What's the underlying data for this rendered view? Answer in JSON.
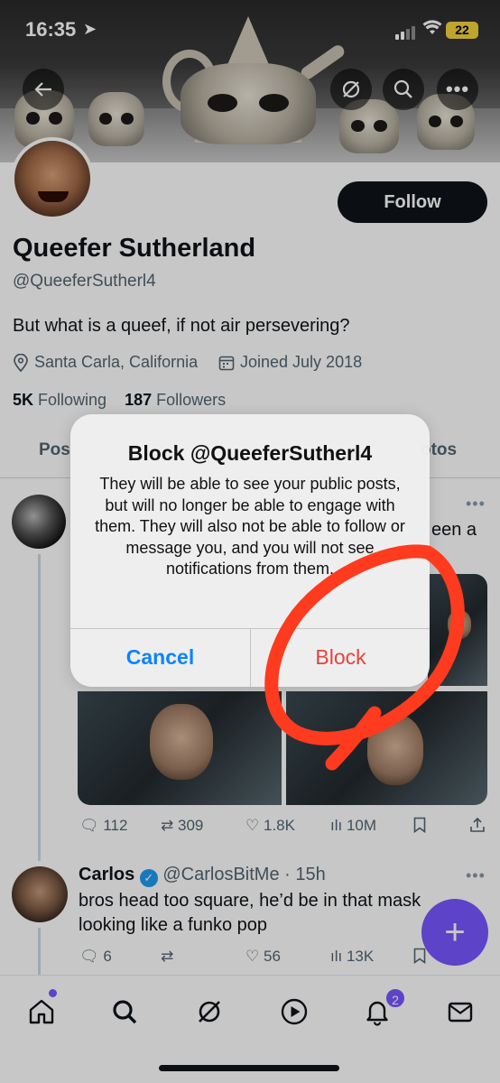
{
  "status_bar": {
    "time": "16:35",
    "battery": "22"
  },
  "profile": {
    "follow_label": "Follow",
    "name": "Queefer Sutherland",
    "handle": "@QueeferSutherl4",
    "bio": "But what is a queef, if not air persevering?",
    "location": "Santa Carla, California",
    "joined": "Joined July 2018",
    "following_count": "5K",
    "following_label": "Following",
    "followers_count": "187",
    "followers_label": "Followers"
  },
  "tabs": [
    "Pos",
    "otos"
  ],
  "tweet1": {
    "text_fragment": "een a",
    "actions": {
      "replies": "112",
      "retweets": "309",
      "likes": "1.8K",
      "views": "10M"
    }
  },
  "tweet2": {
    "name": "Carlos",
    "handle": "@CarlosBitMe",
    "time": "· 15h",
    "text_line1": "bros head too square, he’d be in that mask",
    "text_line2": "looking like a funko pop",
    "actions": {
      "replies": "6",
      "likes": "56",
      "views": "13K"
    }
  },
  "alert": {
    "title": "Block @QueeferSutherl4",
    "message": "They will be able to see your public posts, but will no longer be able to engage with them. They will also not be able to follow or message you, and you will not see notifications from them.",
    "cancel_label": "Cancel",
    "block_label": "Block"
  },
  "bottom_nav": {
    "notifications_badge": "2"
  },
  "colors": {
    "accent": "#7856ff",
    "ios_blue": "#0a84ff",
    "destructive": "#e5443b",
    "annotation": "#ff3b1f"
  }
}
